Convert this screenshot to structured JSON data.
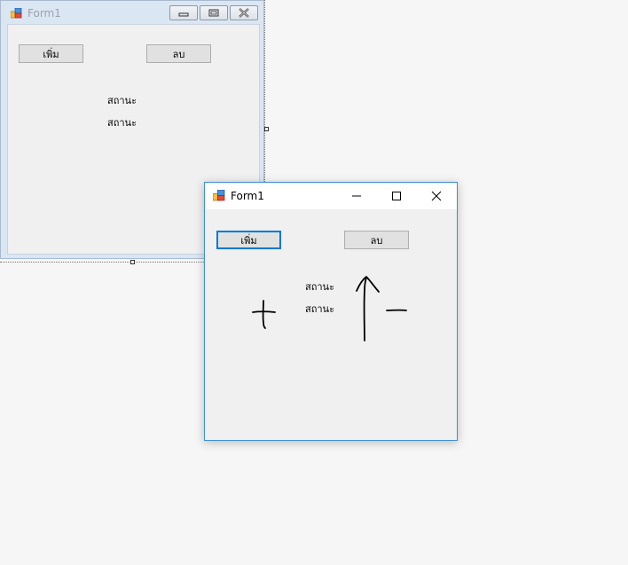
{
  "designer_window": {
    "title": "Form1",
    "add_button": "เพิ่ม",
    "delete_button": "ลบ",
    "status_label_1": "สถานะ",
    "status_label_2": "สถานะ"
  },
  "running_window": {
    "title": "Form1",
    "add_button": "เพิ่ม",
    "delete_button": "ลบ",
    "status_label_1": "สถานะ",
    "status_label_2": "สถานะ"
  },
  "icons": {
    "app": "winforms-app-icon",
    "minimize": "minimize-icon",
    "maximize": "maximize-icon",
    "close": "close-icon",
    "annotation_plus": "handwritten-plus-icon",
    "annotation_arrow": "handwritten-up-arrow-icon",
    "annotation_minus": "handwritten-minus-icon"
  },
  "colors": {
    "accent": "#0078d7",
    "window_border": "#3a8fd6",
    "form_background": "#f0f0f0"
  }
}
